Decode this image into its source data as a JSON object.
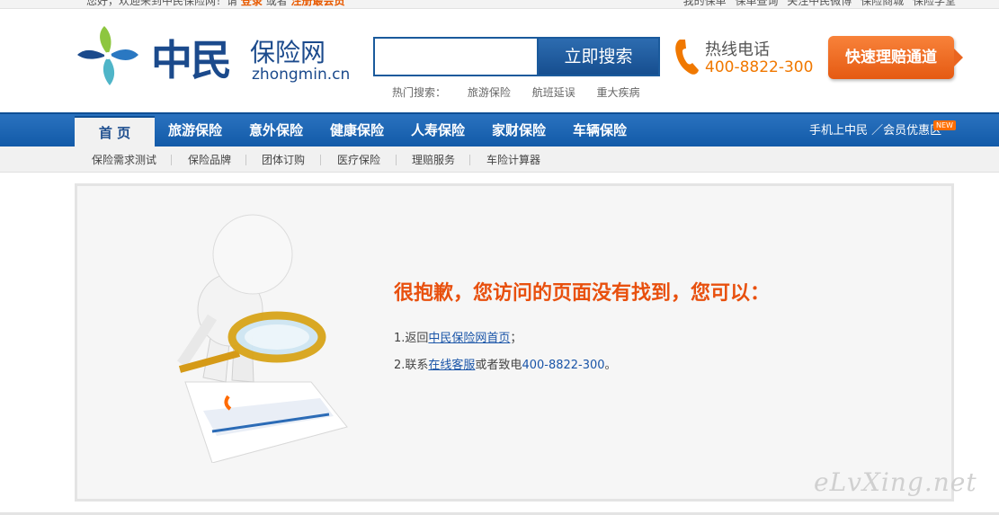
{
  "topbar": {
    "left_text": "您好，欢迎来到中民保险网！请",
    "login": "登录",
    "or": "或者",
    "register": "注册最会员",
    "right_items": [
      "我的保单",
      "保单查询",
      "关注中民微博",
      "保险商城",
      "保险学堂"
    ]
  },
  "logo": {
    "cn": "中民",
    "cn2": "保险网",
    "en": "zhongmin.cn"
  },
  "search": {
    "placeholder": "",
    "button": "立即搜索"
  },
  "hot_search": {
    "label": "热门搜索：",
    "items": [
      "旅游保险",
      "航班延误",
      "重大疾病"
    ]
  },
  "hotline": {
    "label": "热线电话",
    "number": "400-8822-300"
  },
  "claim_button": "快速理赔通道",
  "nav": {
    "tabs": [
      "首 页",
      "旅游保险",
      "意外保险",
      "健康保险",
      "人寿保险",
      "家财保险",
      "车辆保险"
    ],
    "right_text": "手机上中民 ／会员优惠区",
    "badge": "NEW"
  },
  "subnav": [
    "保险需求测试",
    "保险品牌",
    "团体订购",
    "医疗保险",
    "理赔服务",
    "车险计算器"
  ],
  "error": {
    "title": "很抱歉，您访问的页面没有找到，您可以：",
    "line1_prefix": "1.返回",
    "line1_link": "中民保险网首页",
    "line1_suffix": "；",
    "line2_prefix": "2.联系",
    "line2_link": "在线客服",
    "line2_mid": "或者致电",
    "line2_tel": "400-8822-300",
    "line2_suffix": "。"
  },
  "watermark": "eLvXing.net",
  "colors": {
    "primary_blue": "#1b4a8c",
    "nav_blue": "#1a63b0",
    "orange": "#e8500e"
  }
}
